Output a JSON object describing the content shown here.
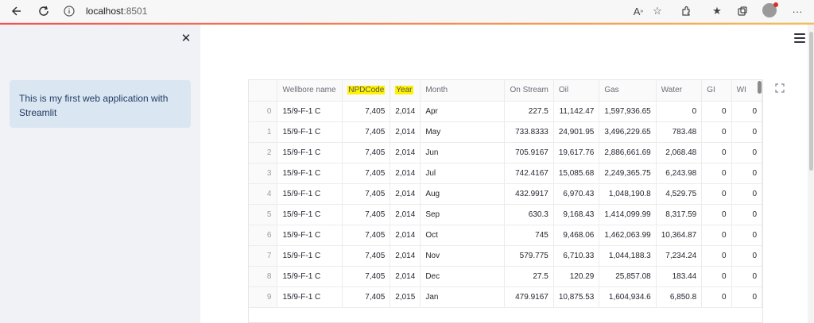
{
  "browser": {
    "url_host": "localhost",
    "url_port": ":8501"
  },
  "sidebar": {
    "info_text": "This is my first web application with Streamlit"
  },
  "table": {
    "columns": [
      "",
      "Wellbore name",
      "NPDCode",
      "Year",
      "Month",
      "On Stream",
      "Oil",
      "Gas",
      "Water",
      "GI",
      "WI"
    ],
    "highlighted_columns": [
      "NPDCode",
      "Year"
    ],
    "rows": [
      [
        "0",
        "15/9-F-1 C",
        "7,405",
        "2,014",
        "Apr",
        "227.5",
        "11,142.47",
        "1,597,936.65",
        "0",
        "0",
        "0"
      ],
      [
        "1",
        "15/9-F-1 C",
        "7,405",
        "2,014",
        "May",
        "733.8333",
        "24,901.95",
        "3,496,229.65",
        "783.48",
        "0",
        "0"
      ],
      [
        "2",
        "15/9-F-1 C",
        "7,405",
        "2,014",
        "Jun",
        "705.9167",
        "19,617.76",
        "2,886,661.69",
        "2,068.48",
        "0",
        "0"
      ],
      [
        "3",
        "15/9-F-1 C",
        "7,405",
        "2,014",
        "Jul",
        "742.4167",
        "15,085.68",
        "2,249,365.75",
        "6,243.98",
        "0",
        "0"
      ],
      [
        "4",
        "15/9-F-1 C",
        "7,405",
        "2,014",
        "Aug",
        "432.9917",
        "6,970.43",
        "1,048,190.8",
        "4,529.75",
        "0",
        "0"
      ],
      [
        "5",
        "15/9-F-1 C",
        "7,405",
        "2,014",
        "Sep",
        "630.3",
        "9,168.43",
        "1,414,099.99",
        "8,317.59",
        "0",
        "0"
      ],
      [
        "6",
        "15/9-F-1 C",
        "7,405",
        "2,014",
        "Oct",
        "745",
        "9,468.06",
        "1,462,063.99",
        "10,364.87",
        "0",
        "0"
      ],
      [
        "7",
        "15/9-F-1 C",
        "7,405",
        "2,014",
        "Nov",
        "579.775",
        "6,710.33",
        "1,044,188.3",
        "7,234.24",
        "0",
        "0"
      ],
      [
        "8",
        "15/9-F-1 C",
        "7,405",
        "2,014",
        "Dec",
        "27.5",
        "120.29",
        "25,857.08",
        "183.44",
        "0",
        "0"
      ],
      [
        "9",
        "15/9-F-1 C",
        "7,405",
        "2,015",
        "Jan",
        "479.9167",
        "10,875.53",
        "1,604,934.6",
        "6,850.8",
        "0",
        "0"
      ]
    ]
  },
  "colors": {
    "accent_start": "#ff4b4b",
    "accent_end": "#ffbd45",
    "highlight": "#fff200",
    "sidebar_bg": "#f0f2f6",
    "info_bg": "#dbe6f3"
  },
  "icons": {
    "back": "back-arrow-icon",
    "refresh": "refresh-icon",
    "info": "info-icon",
    "read_aloud": "read-aloud-icon",
    "favorite_add": "add-favorite-icon",
    "extensions": "extensions-icon",
    "favorites": "favorites-icon",
    "collections": "collections-icon",
    "more": "more-icon",
    "close": "close-icon",
    "menu": "hamburger-menu-icon",
    "fullscreen": "fullscreen-icon"
  }
}
